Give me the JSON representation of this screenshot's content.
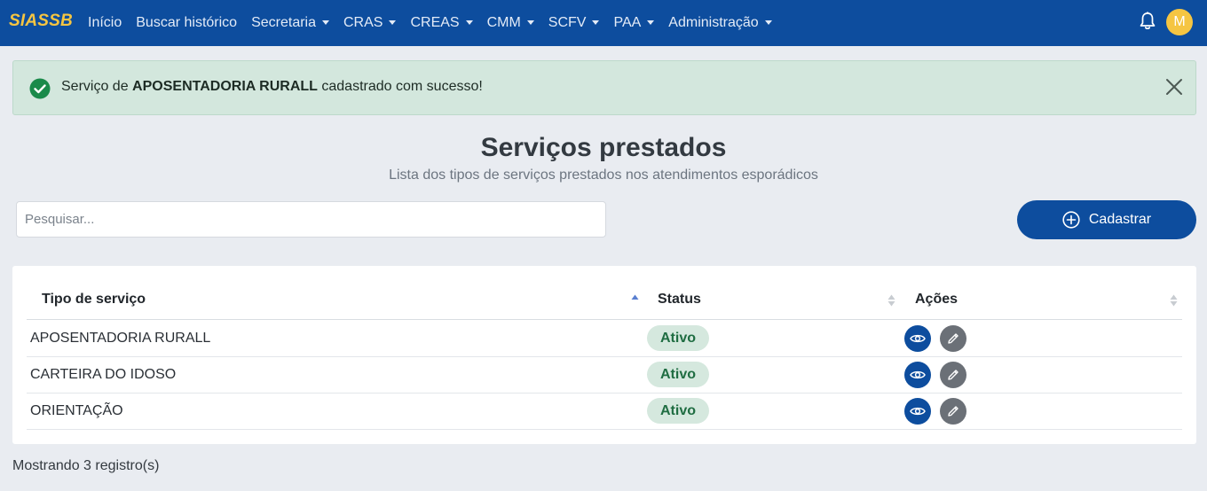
{
  "navbar": {
    "brand": "SIASSB",
    "items": [
      {
        "label": "Início",
        "dropdown": false
      },
      {
        "label": "Buscar histórico",
        "dropdown": false
      },
      {
        "label": "Secretaria",
        "dropdown": true
      },
      {
        "label": "CRAS",
        "dropdown": true
      },
      {
        "label": "CREAS",
        "dropdown": true
      },
      {
        "label": "CMM",
        "dropdown": true
      },
      {
        "label": "SCFV",
        "dropdown": true
      },
      {
        "label": "PAA",
        "dropdown": true
      },
      {
        "label": "Administração",
        "dropdown": true
      }
    ],
    "avatar_initial": "M",
    "colors": {
      "bg": "#0d4d9e",
      "brand": "#f5c542"
    }
  },
  "alert": {
    "prefix": "Serviço de ",
    "bold": "APOSENTADORIA RURALL",
    "suffix": " cadastrado com sucesso!",
    "icon": "check-circle-icon",
    "close_icon": "close-icon"
  },
  "header": {
    "title": "Serviços prestados",
    "subtitle": "Lista dos tipos de serviços prestados nos atendimentos esporádicos"
  },
  "search": {
    "placeholder": "Pesquisar...",
    "value": ""
  },
  "add_button": {
    "label": "Cadastrar",
    "icon": "plus-circle-icon"
  },
  "table": {
    "columns": [
      "Tipo de serviço",
      "Status",
      "Ações"
    ],
    "rows": [
      {
        "tipo": "APOSENTADORIA RURALL",
        "status": "Ativo"
      },
      {
        "tipo": "CARTEIRA DO IDOSO",
        "status": "Ativo"
      },
      {
        "tipo": "ORIENTAÇÃO",
        "status": "Ativo"
      }
    ],
    "action_icons": [
      "eye-icon",
      "pencil-icon"
    ]
  },
  "footer": {
    "count_text": "Mostrando 3 registro(s)"
  }
}
